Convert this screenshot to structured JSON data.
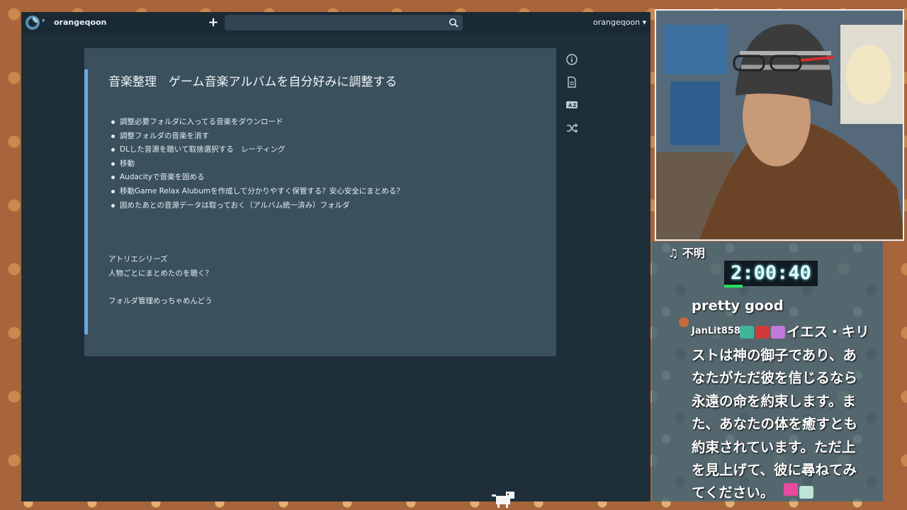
{
  "app": {
    "username_left": "orangeqoon",
    "username_right": "orangeqoon",
    "new_button": "+",
    "search_placeholder": ""
  },
  "note": {
    "title": "音楽整理　ゲーム音楽アルバムを自分好みに調整する",
    "bullets": [
      "調整必要フォルダに入ってる音楽をダウンロード",
      "調整フォルダの音楽を消す",
      "DLした音源を聴いて取捨選択する　レーティング",
      "移動",
      "Audacityで音楽を固める",
      "移動Game Relax Alubumを作成して分かりやすく保管する？安心安全にまとめる？",
      "固めたあとの音源データは取っておく（アルバム統一済み）フォルダ"
    ],
    "paragraphs": [
      "アトリエシリーズ",
      "人物ごとにまとめたのを聴く？",
      "フォルダ管理めっちゃめんどう"
    ]
  },
  "stream": {
    "now_playing": "♫ 不明",
    "timer": "2:00:40",
    "chat_prev": "pretty good",
    "chat_user": "JanLit858",
    "chat_lines": [
      "イエス・キリ",
      "ストは神の御子であり、あ",
      "なたがただ彼を信じるなら",
      "永遠の命を約束します。ま",
      "た、あなたの体を癒すとも",
      "約束されています。ただ上",
      "を見上げて、彼に尋ねてみ",
      "てください。"
    ]
  },
  "colors": {
    "app_bg": "#1e2f3a",
    "card_bg": "#3a505d",
    "accent": "#6ba8e0",
    "timer_bar": "#29e05a"
  }
}
